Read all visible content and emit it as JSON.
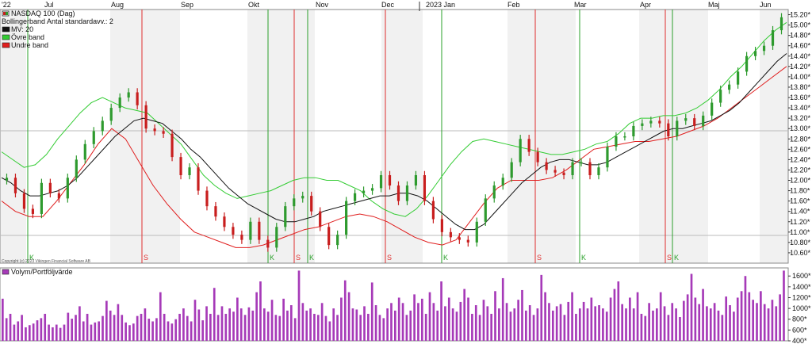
{
  "colors": {
    "up": "#2e9a2e",
    "down": "#c81e1e",
    "ma": "#111111",
    "upper_band": "#33cc33",
    "lower_band": "#e01e1e",
    "volume": "#a63ab8",
    "buy_line": "#2aa02a",
    "sell_line": "#e03030",
    "bg_a": "#f1f1f1",
    "bg_b": "#ffffff",
    "grid": "#dddddd"
  },
  "header": {
    "months": [
      "'22",
      "Jul",
      "Aug",
      "Sep",
      "Okt",
      "Nov",
      "Dec",
      "2023 Jan",
      "Feb",
      "Mar",
      "Apr",
      "Maj",
      "Jun"
    ]
  },
  "legend": {
    "items": [
      {
        "label": "NASDAQ 100 (Dag)",
        "icon": "candle-icon"
      },
      {
        "label": "Bollingerband  Antal standardavv.: 2",
        "icon": "none"
      },
      {
        "label": "MV: 20",
        "icon": "line-icon"
      },
      {
        "label": "Övre band",
        "icon": "line-icon"
      },
      {
        "label": "Undre band",
        "icon": "line-icon"
      }
    ]
  },
  "copyright": "Copyright (c) 2023 Vikingen Financial Software AB",
  "volume_legend": {
    "label": "Volym/Portföljvärde"
  },
  "chart_data": [
    {
      "type": "candlestick",
      "title": "NASDAQ 100 (Dag)",
      "ylim": [
        10.4,
        15.3
      ],
      "y_ticks": [
        "10.60*",
        "10.80*",
        "11.00*",
        "11.20*",
        "11.40*",
        "11.60*",
        "11.80*",
        "12.00*",
        "12.20*",
        "12.40*",
        "12.60*",
        "12.80*",
        "13.00*",
        "13.20*",
        "13.40*",
        "13.60*",
        "13.80*",
        "14.00*",
        "14.20*",
        "14.40*",
        "14.60*",
        "14.80*",
        "15.00*",
        "15.20*"
      ],
      "series": [
        {
          "name": "NASDAQ 100 (Dag)",
          "close": [
            12.05,
            11.75,
            11.45,
            11.35,
            11.95,
            11.75,
            11.65,
            12.05,
            12.4,
            12.7,
            12.95,
            13.15,
            13.4,
            13.6,
            13.7,
            13.45,
            13.0,
            12.95,
            12.9,
            12.45,
            12.1,
            12.25,
            11.8,
            11.5,
            11.3,
            11.1,
            10.95,
            10.85,
            11.2,
            10.85,
            10.7,
            11.1,
            11.5,
            11.65,
            11.7,
            11.4,
            11.1,
            10.75,
            10.95,
            11.6,
            11.75,
            11.8,
            11.85,
            12.1,
            11.9,
            11.6,
            11.9,
            12.1,
            11.6,
            11.25,
            11.0,
            10.9,
            10.85,
            10.8,
            11.2,
            11.65,
            11.9,
            12.05,
            12.35,
            12.8,
            12.55,
            12.35,
            12.2,
            12.15,
            12.1,
            12.35,
            12.35,
            12.1,
            12.25,
            12.65,
            12.85,
            12.85,
            13.05,
            13.1,
            13.15,
            13.1,
            12.85,
            13.15,
            13.2,
            13.05,
            13.25,
            13.5,
            13.75,
            13.85,
            14.1,
            14.4,
            14.5,
            14.6,
            14.9,
            15.15
          ]
        },
        {
          "name": "MV: 20",
          "values": [
            12.05,
            11.95,
            11.8,
            11.7,
            11.7,
            11.75,
            11.8,
            11.9,
            12.05,
            12.25,
            12.45,
            12.65,
            12.85,
            13.0,
            13.15,
            13.2,
            13.15,
            13.1,
            12.95,
            12.8,
            12.6,
            12.45,
            12.25,
            12.05,
            11.85,
            11.7,
            11.55,
            11.45,
            11.35,
            11.25,
            11.2,
            11.2,
            11.25,
            11.3,
            11.4,
            11.45,
            11.5,
            11.55,
            11.6,
            11.65,
            11.7,
            11.7,
            11.75,
            11.75,
            11.7,
            11.6,
            11.45,
            11.3,
            11.15,
            11.05,
            11.05,
            11.15,
            11.35,
            11.55,
            11.75,
            11.95,
            12.1,
            12.25,
            12.35,
            12.4,
            12.4,
            12.35,
            12.3,
            12.3,
            12.35,
            12.45,
            12.55,
            12.65,
            12.75,
            12.85,
            12.95,
            13.0,
            13.0,
            13.05,
            13.1,
            13.15,
            13.25,
            13.35,
            13.5,
            13.7,
            13.9,
            14.1,
            14.3,
            14.45
          ]
        },
        {
          "name": "Övre band",
          "values": [
            12.55,
            12.4,
            12.25,
            12.3,
            12.5,
            12.8,
            13.05,
            13.3,
            13.5,
            13.6,
            13.5,
            13.4,
            13.35,
            13.3,
            13.1,
            12.9,
            12.7,
            12.4,
            12.1,
            11.9,
            11.75,
            11.65,
            11.7,
            11.75,
            11.8,
            11.9,
            12.0,
            12.05,
            12.05,
            12.0,
            12.0,
            11.9,
            11.8,
            11.6,
            11.45,
            11.35,
            11.3,
            11.45,
            11.7,
            12.0,
            12.3,
            12.55,
            12.75,
            12.8,
            12.75,
            12.7,
            12.65,
            12.6,
            12.55,
            12.5,
            12.5,
            12.55,
            12.6,
            12.7,
            12.75,
            12.9,
            13.1,
            13.2,
            13.2,
            13.25,
            13.25,
            13.3,
            13.4,
            13.55,
            13.75,
            14.0,
            14.2,
            14.45,
            14.7,
            14.9,
            15.05
          ]
        },
        {
          "name": "Undre band",
          "values": [
            11.6,
            11.4,
            11.3,
            11.3,
            11.6,
            11.95,
            12.3,
            12.7,
            13.0,
            12.8,
            12.35,
            11.9,
            11.55,
            11.25,
            11.0,
            10.9,
            10.8,
            10.7,
            10.7,
            10.75,
            10.85,
            10.95,
            11.05,
            11.1,
            11.2,
            11.3,
            11.35,
            11.3,
            11.2,
            11.05,
            10.9,
            10.8,
            10.75,
            10.85,
            11.2,
            11.55,
            11.85,
            12.0,
            12.0,
            12.0,
            12.05,
            12.2,
            12.4,
            12.6,
            12.65,
            12.7,
            12.75,
            12.75,
            12.8,
            12.85,
            12.95,
            13.05,
            13.2,
            13.4,
            13.6,
            13.8,
            14.0,
            14.2
          ]
        }
      ],
      "signals": [
        {
          "label": "K"
        },
        {
          "label": "S"
        },
        {
          "label": "K"
        },
        {
          "label": "S"
        },
        {
          "label": "K"
        },
        {
          "label": "S"
        },
        {
          "label": "K"
        },
        {
          "label": "S"
        },
        {
          "label": "K"
        },
        {
          "label": "S"
        },
        {
          "label": "K"
        }
      ]
    },
    {
      "type": "bar",
      "title": "Volym/Portföljvärde",
      "ylim": [
        400,
        1750
      ],
      "y_ticks": [
        "400*",
        "600*",
        "800*",
        "1000*",
        "1200*",
        "1400*",
        "1600*"
      ],
      "values": [
        1180,
        820,
        900,
        700,
        760,
        880,
        650,
        690,
        720,
        780,
        820,
        900,
        700,
        650,
        700,
        640,
        700,
        920,
        810,
        880,
        1040,
        760,
        900,
        700,
        740,
        760,
        860,
        1140,
        960,
        880,
        1080,
        880,
        740,
        690,
        720,
        860,
        900,
        1000,
        810,
        760,
        820,
        1300,
        900,
        760,
        720,
        800,
        900,
        1000,
        860,
        760,
        1160,
        980,
        780,
        1040,
        900,
        1380,
        880,
        1040,
        900,
        1000,
        940,
        1200,
        1000,
        880,
        1020,
        960,
        1300,
        1500,
        1000,
        940,
        1160,
        880,
        860,
        1180,
        960,
        1060,
        820,
        1700,
        1100,
        960,
        1000,
        900,
        880,
        1100,
        860,
        760,
        1000,
        880,
        1200,
        1520,
        1300,
        1000,
        980,
        880,
        1040,
        900,
        1480,
        1060,
        880,
        820,
        1000,
        1100,
        960,
        1200,
        1100,
        880,
        960,
        1260,
        1100,
        1180,
        900,
        1300,
        1100,
        960,
        1500,
        1040,
        1200,
        1000,
        940,
        1120,
        1360,
        1200,
        900,
        1060,
        880,
        1160,
        1040,
        900,
        1320,
        1000,
        1560,
        1100,
        940,
        1000,
        1160,
        1340,
        960,
        1060,
        880,
        1000,
        1620,
        1300,
        1100,
        960,
        1040,
        1080,
        880,
        1120,
        1300,
        900,
        1000,
        1120,
        1000,
        1200,
        1040,
        1060,
        1000,
        940,
        1200,
        1360,
        1500,
        1080,
        1000,
        1200,
        1000,
        1300,
        900,
        860,
        1100,
        960,
        1000,
        1300,
        1040,
        880,
        1100,
        1000,
        840,
        1140,
        1260,
        1640,
        1200,
        1080,
        1360,
        1040,
        1000,
        1100,
        960,
        880,
        1220,
        1060,
        940,
        1200,
        1320,
        1600,
        1300,
        1160,
        1100,
        1320,
        1080,
        1000,
        1160,
        1040,
        1260,
        1700
      ]
    }
  ]
}
